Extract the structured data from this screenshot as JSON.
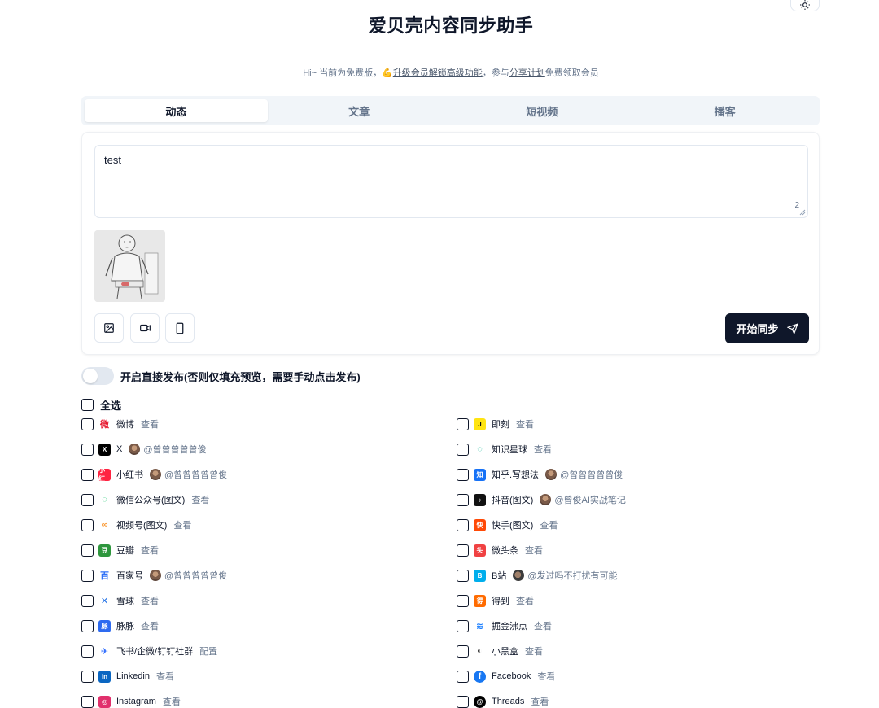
{
  "title": "爱贝壳内容同步助手",
  "notice": {
    "prefix": "Hi~ 当前为免费版，",
    "emoji": "💪",
    "upgrade_link": "升级会员解锁高级功能",
    "middle": "，参与",
    "share_link": "分享计划",
    "suffix": "免费领取会员"
  },
  "tabs": [
    {
      "label": "动态",
      "active": true
    },
    {
      "label": "文章",
      "active": false
    },
    {
      "label": "短视频",
      "active": false
    },
    {
      "label": "播客",
      "active": false
    }
  ],
  "editor": {
    "value": "test",
    "char_count": "2"
  },
  "actions": {
    "image_icon": "image-icon",
    "video_icon": "video-icon",
    "device_icon": "smartphone-icon",
    "sync_label": "开始同步"
  },
  "direct_publish": {
    "label": "开启直接发布(否则仅填充预览，需要手动点击发布)",
    "enabled": false
  },
  "select_all": {
    "label": "全选",
    "checked": false
  },
  "platforms_left": [
    {
      "name": "微博",
      "link": "查看",
      "icon": "weibo-icon",
      "color": "#e6162d"
    },
    {
      "name": "X",
      "account": "@曾曾曾曾曾俊",
      "icon": "x-icon",
      "color": "#000000"
    },
    {
      "name": "小红书",
      "account": "@曾曾曾曾曾俊",
      "icon": "xiaohongshu-icon",
      "color": "#ff2442"
    },
    {
      "name": "微信公众号(图文)",
      "link": "查看",
      "icon": "wechat-mp-icon",
      "color": "#07c160"
    },
    {
      "name": "视频号(图文)",
      "link": "查看",
      "icon": "channels-icon",
      "color": "#fa9d3b"
    },
    {
      "name": "豆瓣",
      "link": "查看",
      "icon": "douban-icon",
      "color": "#2e963d"
    },
    {
      "name": "百家号",
      "account": "@曾曾曾曾曾俊",
      "icon": "baijiahao-icon",
      "color": "#2d6ff7"
    },
    {
      "name": "雪球",
      "link": "查看",
      "icon": "xueqiu-icon",
      "color": "#1f6fe5"
    },
    {
      "name": "脉脉",
      "link": "查看",
      "icon": "maimai-icon",
      "color": "#2e6bf0"
    },
    {
      "name": "飞书/企微/钉钉社群",
      "link": "配置",
      "icon": "feishu-icon",
      "color": "#3370ff"
    },
    {
      "name": "Linkedin",
      "link": "查看",
      "icon": "linkedin-icon",
      "color": "#0a66c2"
    },
    {
      "name": "Instagram",
      "link": "查看",
      "icon": "instagram-icon",
      "color": "#e1306c"
    }
  ],
  "platforms_right": [
    {
      "name": "即刻",
      "link": "查看",
      "icon": "jike-icon",
      "color": "#ffe411"
    },
    {
      "name": "知识星球",
      "link": "查看",
      "icon": "zsxq-icon",
      "color": "#16b998"
    },
    {
      "name": "知乎.写想法",
      "account": "@曾曾曾曾曾俊",
      "icon": "zhihu-icon",
      "color": "#1772f6"
    },
    {
      "name": "抖音(图文)",
      "account": "@曾俊AI实战笔记",
      "icon": "douyin-icon",
      "color": "#111111"
    },
    {
      "name": "快手(图文)",
      "link": "查看",
      "icon": "kuaishou-icon",
      "color": "#ff4906"
    },
    {
      "name": "微头条",
      "link": "查看",
      "icon": "toutiao-icon",
      "color": "#f04142"
    },
    {
      "name": "B站",
      "account": "@发过吗不打扰有可能",
      "icon": "bilibili-icon",
      "color": "#00aeec"
    },
    {
      "name": "得到",
      "link": "查看",
      "icon": "dedao-icon",
      "color": "#ff6b00"
    },
    {
      "name": "掘金沸点",
      "link": "查看",
      "icon": "juejin-icon",
      "color": "#1e80ff"
    },
    {
      "name": "小黑盒",
      "link": "查看",
      "icon": "xiaoheihe-icon",
      "color": "#1a1a1a"
    },
    {
      "name": "Facebook",
      "link": "查看",
      "icon": "facebook-icon",
      "color": "#1877f2"
    },
    {
      "name": "Threads",
      "link": "查看",
      "icon": "threads-icon",
      "color": "#000000"
    }
  ]
}
